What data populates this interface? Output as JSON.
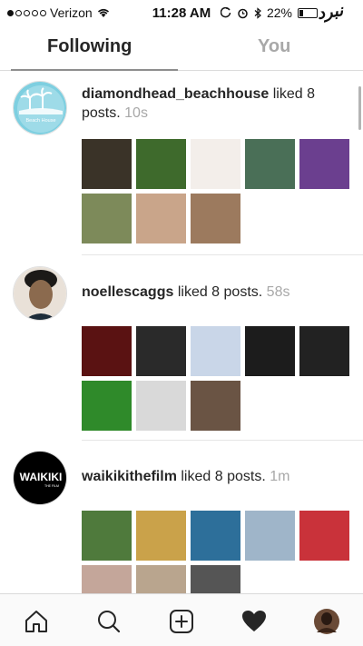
{
  "status_bar": {
    "carrier": "Verizon",
    "time": "11:28 AM",
    "battery": "22%",
    "watermark": "نبرد"
  },
  "tabs": [
    {
      "label": "Following",
      "active": true
    },
    {
      "label": "You",
      "active": false
    }
  ],
  "activities": [
    {
      "username": "diamondhead_beachhouse",
      "action": "liked 8 posts.",
      "time": "10s",
      "avatar_text": "Beach House",
      "avatar_color": "#7ecfe0",
      "thumbnails": [
        "#3a3328",
        "#3e6a2c",
        "#f3eeea",
        "#4a6f57",
        "#6b3f8f",
        "#7d8a5a",
        "#c9a58a",
        "#9c7a5e"
      ]
    },
    {
      "username": "noellescaggs",
      "action": "liked 8 posts.",
      "time": "58s",
      "avatar_color": "#8b6a4e",
      "thumbnails": [
        "#5a1212",
        "#2a2a2a",
        "#c9d6e8",
        "#1c1c1c",
        "#222222",
        "#2f8a2a",
        "#d9d9d9",
        "#6a5444"
      ]
    },
    {
      "username": "waikikithefilm",
      "action": "liked 8 posts.",
      "time": "1m",
      "avatar_text": "WAIKIKI",
      "avatar_subtext": "THE FILM",
      "avatar_color": "#000000",
      "thumbnails": [
        "#4f7a3c",
        "#caa24a",
        "#2d6f9a",
        "#9fb5c9",
        "#c9323a",
        "#c4a69a",
        "#b9a58e",
        "#555555"
      ]
    }
  ],
  "bottom_nav": {
    "items": [
      "home-icon",
      "search-icon",
      "add-post-icon",
      "heart-icon",
      "profile-avatar"
    ],
    "active": "heart-icon",
    "avatar_color": "#6a4a36"
  },
  "colors": {
    "accent_text": "#262626",
    "muted_text": "#a8a8a8",
    "divider": "#e6e6e6"
  }
}
